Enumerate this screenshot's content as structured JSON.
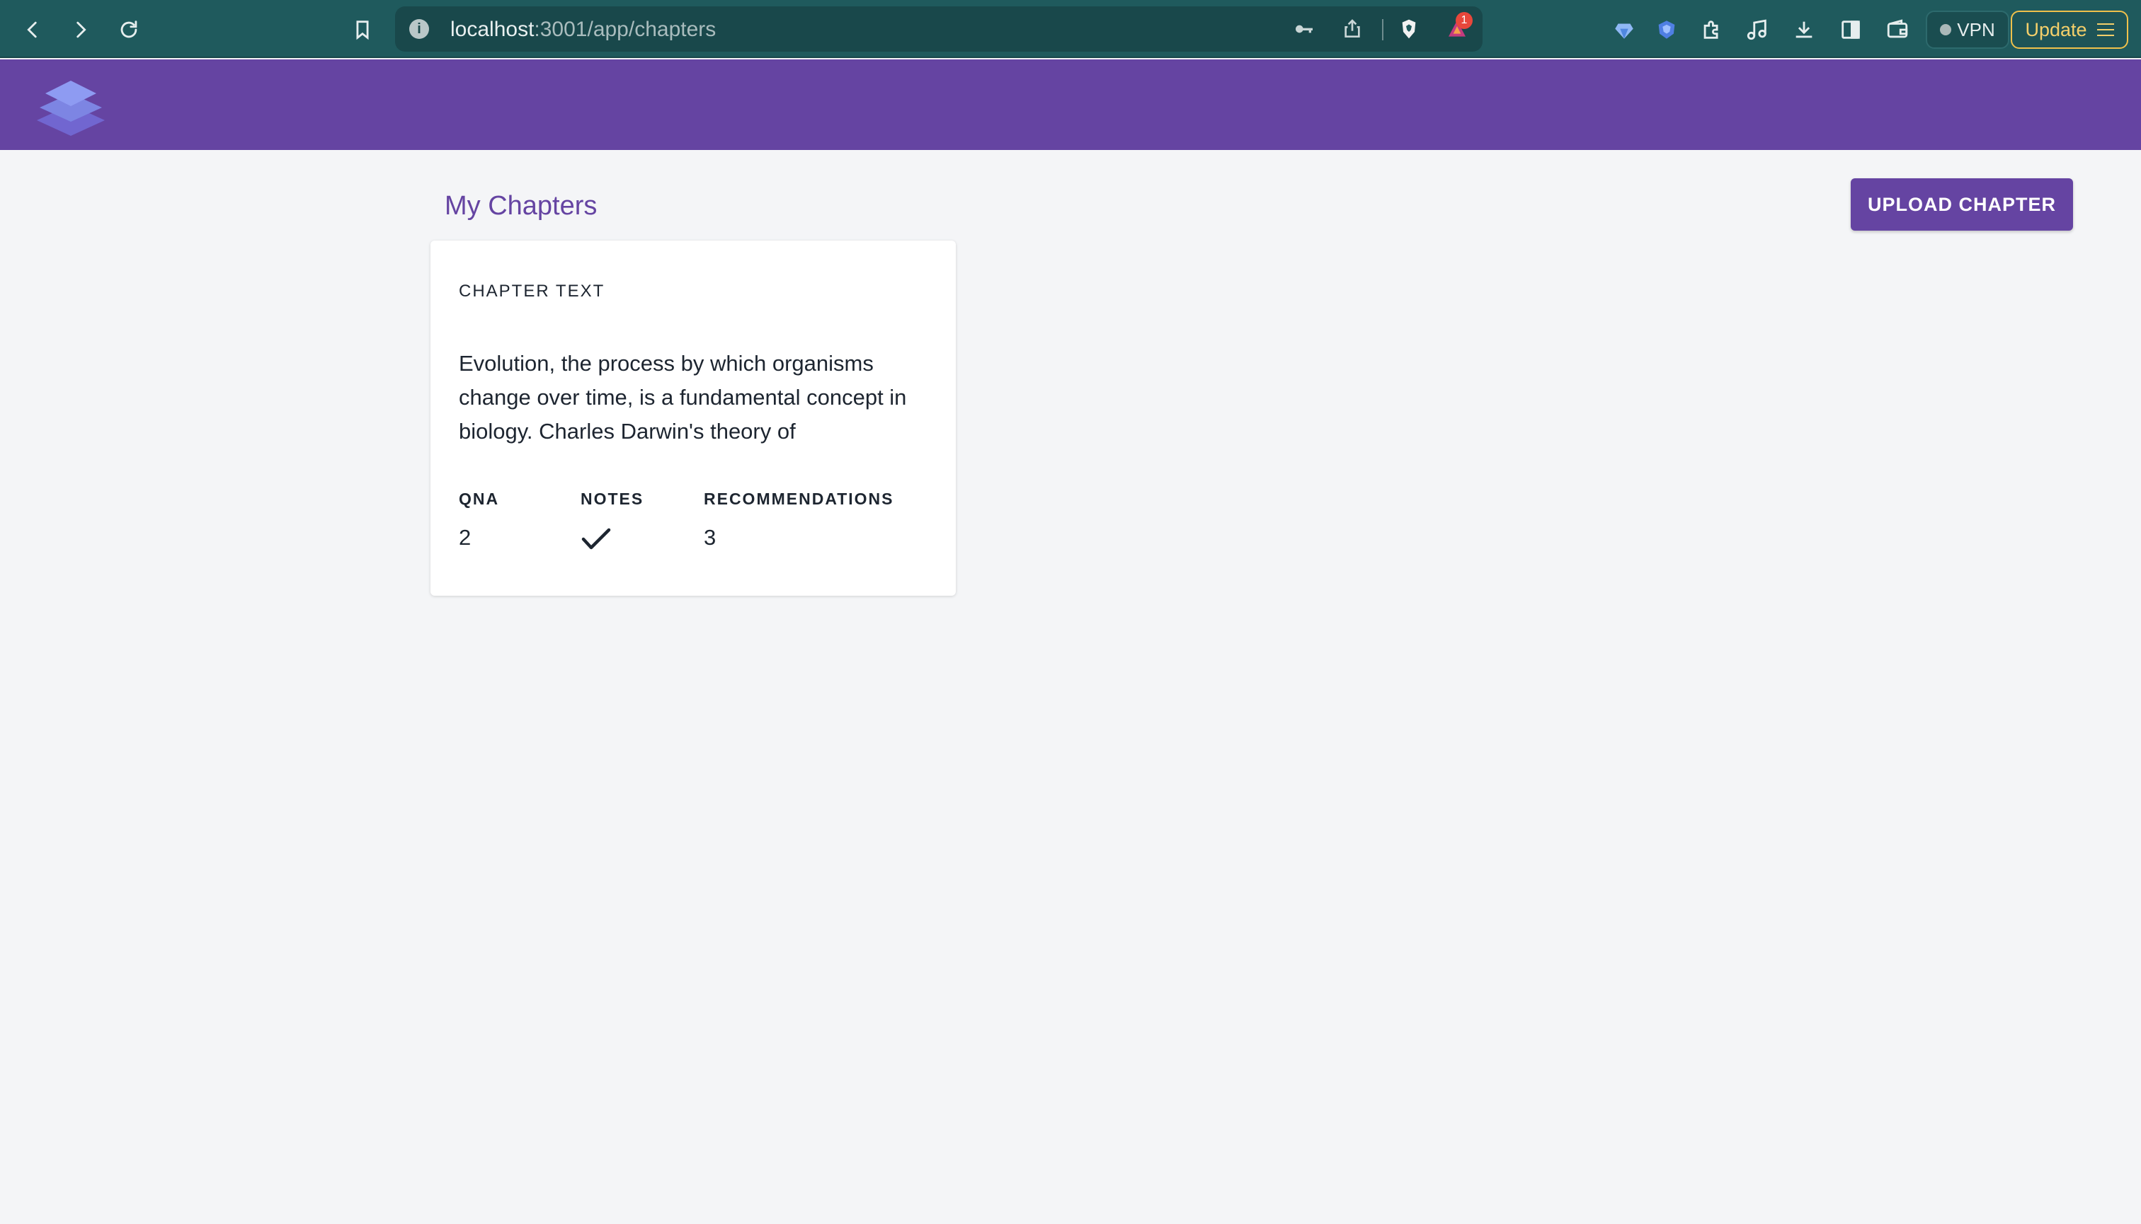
{
  "browser": {
    "url_host": "localhost",
    "url_path": ":3001/app/chapters",
    "alert_badge": "1",
    "vpn_label": "VPN",
    "update_label": "Update"
  },
  "header": {
    "logo_icon": "layers-icon",
    "brand_colors": {
      "primary": "#6544a2",
      "logo_light": "#8e9bf2",
      "logo_dark": "#7166d0"
    }
  },
  "main": {
    "title": "My Chapters",
    "upload_label": "UPLOAD CHAPTER",
    "chapters": [
      {
        "label": "CHAPTER TEXT",
        "text": "Evolution, the process by which organisms change over time, is a fundamental concept in biology. Charles Darwin's theory of",
        "stats": {
          "qna_label": "QNA",
          "qna_value": "2",
          "notes_label": "NOTES",
          "notes_icon": "checkmark-icon",
          "recs_label": "RECOMMENDATIONS",
          "recs_value": "3"
        }
      }
    ]
  }
}
